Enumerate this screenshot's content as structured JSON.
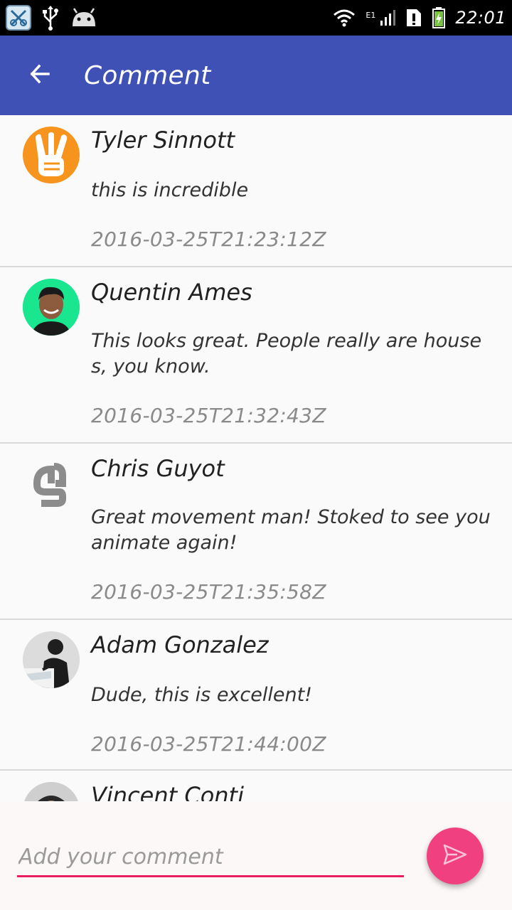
{
  "status_bar": {
    "time": "22:01",
    "network_label": "E1",
    "icons": [
      "notification-app-icon",
      "usb-icon",
      "android-icon",
      "wifi-icon",
      "signal-icon",
      "sim-alert-icon",
      "battery-charging-icon"
    ]
  },
  "app_bar": {
    "title": "Comment",
    "back_icon": "arrow-back-icon",
    "color": "#3f51b5"
  },
  "comments": [
    {
      "name": "Tyler Sinnott",
      "text": "this is incredible",
      "date": "2016-03-25T21:23:12Z",
      "avatar": "peace-hand-avatar"
    },
    {
      "name": "Quentin Ames",
      "text": "This looks great. People really are house s, you know.",
      "date": "2016-03-25T21:32:43Z",
      "avatar": "photo-avatar"
    },
    {
      "name": "Chris Guyot",
      "text": "Great movement man! Stoked to see you animate again!",
      "date": "2016-03-25T21:35:58Z",
      "avatar": "g-logo-avatar"
    },
    {
      "name": "Adam Gonzalez",
      "text": "Dude, this is excellent!",
      "date": "2016-03-25T21:44:00Z",
      "avatar": "photo-avatar"
    },
    {
      "name": "Vincent Conti",
      "text": "",
      "date": "",
      "avatar": "photo-avatar"
    }
  ],
  "composer": {
    "placeholder": "Add your comment",
    "value": "",
    "send_icon": "send-icon",
    "accent_color": "#e91e63"
  }
}
